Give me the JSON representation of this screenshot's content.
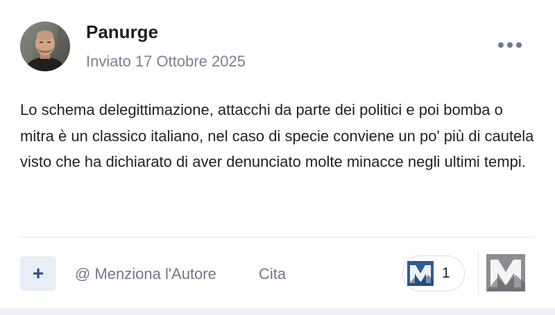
{
  "post": {
    "author": "Panurge",
    "date": "Inviato 17 Ottobre 2025",
    "body": "Lo schema delegittimazione, attacchi da parte dei politici e poi bomba o mitra è un classico italiano, nel caso di specie conviene un po' più di cautela visto che ha dichiarato di aver denunciato molte minacce negli ultimi tempi."
  },
  "actions": {
    "plus_label": "+",
    "mention_label": "@ Menziona l'Autore",
    "quote_label": "Cita"
  },
  "reactions": {
    "count": "1"
  },
  "icons": {
    "more": "more-options-icon",
    "reaction": "reaction-logo-icon",
    "react_button": "reaction-logo-grey-icon"
  },
  "colors": {
    "accent": "#2b4a74",
    "muted_text": "#7a8290",
    "plus_bg": "#e8eef6"
  }
}
